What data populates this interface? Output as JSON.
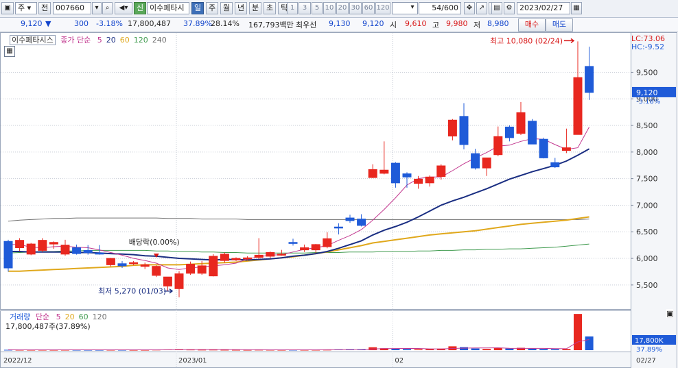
{
  "toolbar": {
    "market": "주",
    "prefix": "전",
    "code": "007660",
    "flag": "신",
    "name": "이수페타시",
    "periods": [
      "일",
      "주",
      "월",
      "년",
      "분",
      "초",
      "틱"
    ],
    "active_period": "일",
    "numbers": [
      "1",
      "3",
      "5",
      "10",
      "20",
      "30",
      "60",
      "120"
    ],
    "count": "54",
    "count_total": "/600",
    "date": "2023/02/27"
  },
  "quote": {
    "price": "9,120",
    "change_arrow": "▼",
    "change": "300",
    "change_pct": "-3.18%",
    "volume": "17,800,487",
    "volume_ratio": "37.89%",
    "turnover_pct": "28.14%",
    "amount": "167,793백만",
    "priority_label": "최우선",
    "bid": "9,130",
    "ask": "9,120",
    "open_label": "시",
    "open": "9,610",
    "high_label": "고",
    "high": "9,980",
    "low_label": "저",
    "low": "8,980",
    "buy_label": "매수",
    "sell_label": "매도"
  },
  "colors": {
    "up": "#e8271f",
    "down": "#1f5bd8",
    "ma5": "#c2378f",
    "ma20": "#1a2e82",
    "ma60": "#e0a81c",
    "ma120": "#3f9a4e",
    "ma240": "#707070"
  },
  "chart_data": [
    {
      "type": "candlestick",
      "title": "이수페타시스",
      "legend": {
        "prefix": "종가 단순",
        "items": [
          {
            "label": "5",
            "color": "#c2378f"
          },
          {
            "label": "20",
            "color": "#1a2e82"
          },
          {
            "label": "60",
            "color": "#e0a81c"
          },
          {
            "label": "120",
            "color": "#3f9a4e"
          },
          {
            "label": "240",
            "color": "#707070"
          }
        ]
      },
      "y_ticks": [
        5500,
        6000,
        6500,
        7000,
        7500,
        8000,
        8500,
        9000,
        9500
      ],
      "ylim": [
        5150,
        10150
      ],
      "x_labels": [
        {
          "i": 0,
          "text": "2022/12"
        },
        {
          "i": 15,
          "text": "2023/01"
        },
        {
          "i": 34,
          "text": "02"
        },
        {
          "i": 55,
          "text": "02/27"
        }
      ],
      "ohlc": [
        [
          6320,
          6350,
          5750,
          5820
        ],
        [
          6200,
          6380,
          6140,
          6340
        ],
        [
          6080,
          6290,
          6060,
          6270
        ],
        [
          6150,
          6380,
          6120,
          6340
        ],
        [
          6270,
          6320,
          6180,
          6300
        ],
        [
          6080,
          6350,
          6050,
          6250
        ],
        [
          6200,
          6260,
          6070,
          6090
        ],
        [
          6150,
          6250,
          6070,
          6110
        ],
        [
          6100,
          6250,
          6070,
          6080
        ],
        [
          5880,
          6010,
          5850,
          6000
        ],
        [
          5900,
          5950,
          5820,
          5860
        ],
        [
          5900,
          5950,
          5870,
          5920
        ],
        [
          5850,
          5920,
          5800,
          5880
        ],
        [
          5680,
          5870,
          5650,
          5850
        ],
        [
          5480,
          5650,
          5380,
          5650
        ],
        [
          5430,
          5760,
          5270,
          5710
        ],
        [
          5720,
          5940,
          5690,
          5890
        ],
        [
          5720,
          5950,
          5690,
          5860
        ],
        [
          5670,
          6080,
          5660,
          6040
        ],
        [
          5960,
          6110,
          5920,
          6080
        ],
        [
          5970,
          6020,
          5950,
          6000
        ],
        [
          5990,
          6040,
          5960,
          6010
        ],
        [
          6020,
          6380,
          5990,
          6060
        ],
        [
          6040,
          6130,
          6000,
          6110
        ],
        [
          6060,
          6160,
          6050,
          6080
        ],
        [
          6300,
          6370,
          6240,
          6280
        ],
        [
          6160,
          6260,
          6120,
          6200
        ],
        [
          6160,
          6270,
          6100,
          6260
        ],
        [
          6220,
          6490,
          6190,
          6370
        ],
        [
          6590,
          6660,
          6450,
          6570
        ],
        [
          6760,
          6820,
          6670,
          6710
        ],
        [
          6740,
          6830,
          6600,
          6620
        ],
        [
          7520,
          7770,
          7510,
          7670
        ],
        [
          7600,
          8200,
          7580,
          7660
        ],
        [
          7790,
          7810,
          7330,
          7420
        ],
        [
          7590,
          7620,
          7330,
          7530
        ],
        [
          7410,
          7550,
          7310,
          7490
        ],
        [
          7420,
          7560,
          7350,
          7530
        ],
        [
          7540,
          7770,
          7480,
          7740
        ],
        [
          8300,
          8620,
          8220,
          8600
        ],
        [
          8670,
          8920,
          8050,
          8140
        ],
        [
          7970,
          8060,
          7670,
          7700
        ],
        [
          7700,
          7840,
          7550,
          7890
        ],
        [
          7950,
          8480,
          7920,
          8290
        ],
        [
          8470,
          8500,
          8200,
          8270
        ],
        [
          8350,
          8940,
          8320,
          8740
        ],
        [
          8580,
          8620,
          8150,
          8150
        ],
        [
          8240,
          8270,
          7880,
          7890
        ],
        [
          7800,
          7890,
          7700,
          7720
        ],
        [
          8030,
          8440,
          7980,
          8080
        ],
        [
          8330,
          10080,
          8330,
          9400
        ],
        [
          9610,
          9980,
          8980,
          9120
        ]
      ],
      "ma": {
        "ma5": [
          6260,
          6260,
          6210,
          6200,
          6220,
          6230,
          6210,
          6200,
          6160,
          6110,
          6060,
          6000,
          5960,
          5910,
          5820,
          5790,
          5820,
          5840,
          5860,
          5880,
          5910,
          5990,
          6030,
          6060,
          6070,
          6120,
          6170,
          6200,
          6240,
          6340,
          6430,
          6540,
          6720,
          6920,
          7140,
          7380,
          7500,
          7530,
          7530,
          7650,
          7780,
          7890,
          7990,
          8110,
          8130,
          8200,
          8250,
          8240,
          8140,
          8050,
          8080,
          8470
        ],
        "ma20": [
          6130,
          6130,
          6120,
          6120,
          6120,
          6120,
          6110,
          6110,
          6100,
          6090,
          6080,
          6070,
          6050,
          6040,
          6020,
          6000,
          5990,
          5980,
          5970,
          5980,
          5980,
          5970,
          5980,
          5990,
          6010,
          6040,
          6060,
          6090,
          6130,
          6190,
          6260,
          6330,
          6440,
          6530,
          6600,
          6680,
          6780,
          6890,
          7000,
          7080,
          7150,
          7230,
          7310,
          7400,
          7490,
          7560,
          7630,
          7690,
          7750,
          7830,
          7940,
          8060
        ],
        "ma60": [
          5760,
          5760,
          5770,
          5780,
          5790,
          5800,
          5810,
          5820,
          5830,
          5840,
          5850,
          5870,
          5880,
          5880,
          5880,
          5880,
          5890,
          5900,
          5910,
          5920,
          5930,
          5950,
          5970,
          5990,
          6010,
          6030,
          6060,
          6090,
          6120,
          6160,
          6200,
          6240,
          6290,
          6320,
          6350,
          6380,
          6410,
          6440,
          6460,
          6480,
          6500,
          6520,
          6550,
          6580,
          6610,
          6640,
          6660,
          6680,
          6700,
          6720,
          6750,
          6780
        ],
        "ma120": [
          6100,
          6110,
          6120,
          6130,
          6130,
          6140,
          6140,
          6150,
          6150,
          6150,
          6150,
          6150,
          6150,
          6140,
          6140,
          6130,
          6130,
          6120,
          6120,
          6110,
          6110,
          6100,
          6100,
          6100,
          6100,
          6100,
          6100,
          6110,
          6110,
          6110,
          6120,
          6120,
          6120,
          6130,
          6130,
          6130,
          6140,
          6140,
          6150,
          6150,
          6160,
          6160,
          6170,
          6170,
          6180,
          6180,
          6190,
          6200,
          6210,
          6230,
          6250,
          6270
        ],
        "ma240": [
          6700,
          6720,
          6730,
          6740,
          6750,
          6750,
          6760,
          6760,
          6760,
          6760,
          6760,
          6760,
          6760,
          6760,
          6750,
          6750,
          6750,
          6740,
          6740,
          6740,
          6740,
          6730,
          6730,
          6730,
          6730,
          6730,
          6730,
          6730,
          6730,
          6730,
          6730,
          6730,
          6730,
          6730,
          6730,
          6730,
          6730,
          6730,
          6730,
          6730,
          6730,
          6730,
          6730,
          6730,
          6730,
          6730,
          6730,
          6730,
          6730,
          6730,
          6730,
          6740
        ]
      },
      "annotations": {
        "max": {
          "label": "최고 10,080 (02/24)",
          "i": 50,
          "value": 10080
        },
        "min": {
          "label": "최저 5,270 (01/03)",
          "i": 15,
          "value": 5270
        },
        "dividend": {
          "label": "배당락(0.00%)",
          "i": 13
        },
        "lc": "LC:73.06",
        "hc": "HC:-9.52",
        "current": "9,120",
        "current_pct": "-3.18%"
      }
    },
    {
      "type": "bar",
      "title": "거래량",
      "legend": {
        "prefix": "단순",
        "items": [
          {
            "label": "5",
            "color": "#c2378f"
          },
          {
            "label": "20",
            "color": "#e0a81c"
          },
          {
            "label": "60",
            "color": "#3f9a4e"
          },
          {
            "label": "120",
            "color": "#707070"
          }
        ]
      },
      "info": "17,800,487주(37.89%)",
      "ylim": [
        0,
        48000000
      ],
      "current_label": "17,800K",
      "current_pct": "37.89%",
      "volumes": [
        500000,
        450000,
        420000,
        430000,
        400000,
        440000,
        420000,
        400000,
        380000,
        450000,
        420000,
        380000,
        400000,
        650000,
        900000,
        1300000,
        750000,
        600000,
        650000,
        500000,
        450000,
        400000,
        550000,
        480000,
        420000,
        500000,
        450000,
        480000,
        600000,
        1000000,
        1300000,
        1100000,
        3800000,
        2500000,
        2100000,
        1500000,
        1200000,
        1300000,
        2000000,
        5000000,
        4000000,
        2200000,
        1600000,
        2700000,
        2100000,
        3100000,
        2000000,
        1600000,
        1300000,
        1500000,
        47000000,
        17800487
      ]
    }
  ]
}
